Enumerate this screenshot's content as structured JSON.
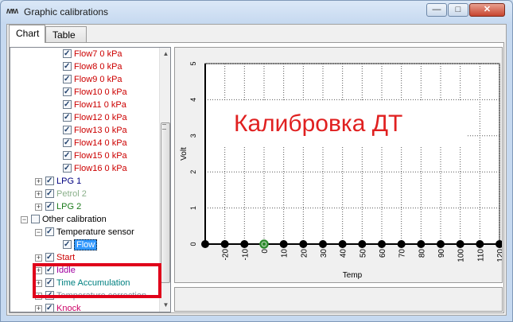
{
  "window": {
    "title": "Graphic calibrations",
    "controls": {
      "minimize": "—",
      "maximize": "□",
      "close": "✕"
    }
  },
  "tabs": [
    {
      "label": "Chart"
    },
    {
      "label": "Table"
    }
  ],
  "tree": {
    "items": [
      {
        "label": "Flow7  0 kPa"
      },
      {
        "label": "Flow8  0 kPa"
      },
      {
        "label": "Flow9  0 kPa"
      },
      {
        "label": "Flow10  0 kPa"
      },
      {
        "label": "Flow11  0 kPa"
      },
      {
        "label": "Flow12  0 kPa"
      },
      {
        "label": "Flow13  0 kPa"
      },
      {
        "label": "Flow14  0 kPa"
      },
      {
        "label": "Flow15  0 kPa"
      },
      {
        "label": "Flow16  0 kPa"
      },
      {
        "label": "LPG 1"
      },
      {
        "label": "Petrol 2"
      },
      {
        "label": "LPG 2"
      },
      {
        "label": "Other calibration"
      },
      {
        "label": "Temperature sensor"
      },
      {
        "label": "Flow"
      },
      {
        "label": "Start"
      },
      {
        "label": "Iddle"
      },
      {
        "label": "Time Accumulation"
      },
      {
        "label": "Temperature correction"
      },
      {
        "label": "Knock"
      }
    ]
  },
  "overlay": {
    "text": "Калибровка ДТ"
  },
  "chart_data": {
    "type": "line",
    "xlabel": "Temp",
    "ylabel": "Volt",
    "xlim": [
      -30,
      120
    ],
    "ylim": [
      0,
      5
    ],
    "x_ticks": [
      -20,
      -10,
      0,
      10,
      20,
      30,
      40,
      50,
      60,
      70,
      80,
      90,
      100,
      110,
      120
    ],
    "y_ticks": [
      0,
      1,
      2,
      3,
      4,
      5
    ],
    "grid": true,
    "series": [
      {
        "x": [
          -30,
          -20,
          -10,
          0,
          10,
          20,
          30,
          40,
          50,
          60,
          70,
          80,
          90,
          100,
          110,
          120
        ],
        "y": [
          0,
          0,
          0,
          0,
          0,
          0,
          0,
          0,
          0,
          0,
          0,
          0,
          0,
          0,
          0,
          0
        ],
        "color": "#000000",
        "highlighted_x": 0,
        "highlight_color": "#2e8b2e"
      }
    ]
  }
}
